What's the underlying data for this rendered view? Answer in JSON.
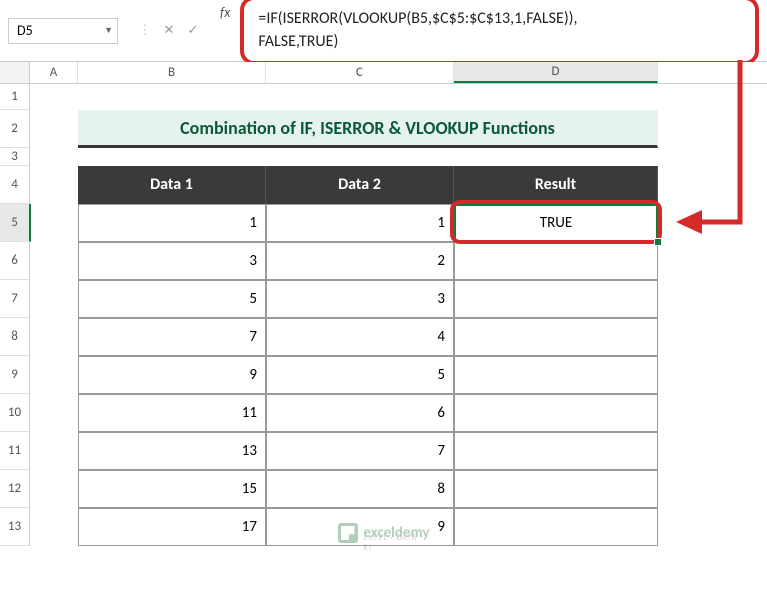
{
  "namebox": "D5",
  "formula": "=IF(ISERROR(VLOOKUP(B5,$C$5:$C$13,1,FALSE)),\nFALSE,TRUE)",
  "columns": [
    "A",
    "B",
    "C",
    "D"
  ],
  "rows": [
    "1",
    "2",
    "3",
    "4",
    "5",
    "6",
    "7",
    "8",
    "9",
    "10",
    "11",
    "12",
    "13"
  ],
  "title": "Combination of IF, ISERROR & VLOOKUP  Functions",
  "headers": {
    "b": "Data 1",
    "c": "Data 2",
    "d": "Result"
  },
  "data": [
    {
      "b": "1",
      "c": "1",
      "d": "TRUE"
    },
    {
      "b": "3",
      "c": "2",
      "d": ""
    },
    {
      "b": "5",
      "c": "3",
      "d": ""
    },
    {
      "b": "7",
      "c": "4",
      "d": ""
    },
    {
      "b": "9",
      "c": "5",
      "d": ""
    },
    {
      "b": "11",
      "c": "6",
      "d": ""
    },
    {
      "b": "13",
      "c": "7",
      "d": ""
    },
    {
      "b": "15",
      "c": "8",
      "d": ""
    },
    {
      "b": "17",
      "c": "9",
      "d": ""
    }
  ],
  "watermark": {
    "text": "exceldemy",
    "sub": "EXCEL · DATA · RI"
  },
  "chart_data": {
    "type": "table",
    "title": "Combination of IF, ISERROR & VLOOKUP Functions",
    "columns": [
      "Data 1",
      "Data 2",
      "Result"
    ],
    "rows": [
      [
        1,
        1,
        "TRUE"
      ],
      [
        3,
        2,
        ""
      ],
      [
        5,
        3,
        ""
      ],
      [
        7,
        4,
        ""
      ],
      [
        9,
        5,
        ""
      ],
      [
        11,
        6,
        ""
      ],
      [
        13,
        7,
        ""
      ],
      [
        15,
        8,
        ""
      ],
      [
        17,
        9,
        ""
      ]
    ],
    "formula_cell": "D5",
    "formula": "=IF(ISERROR(VLOOKUP(B5,$C$5:$C$13,1,FALSE)),FALSE,TRUE)"
  }
}
